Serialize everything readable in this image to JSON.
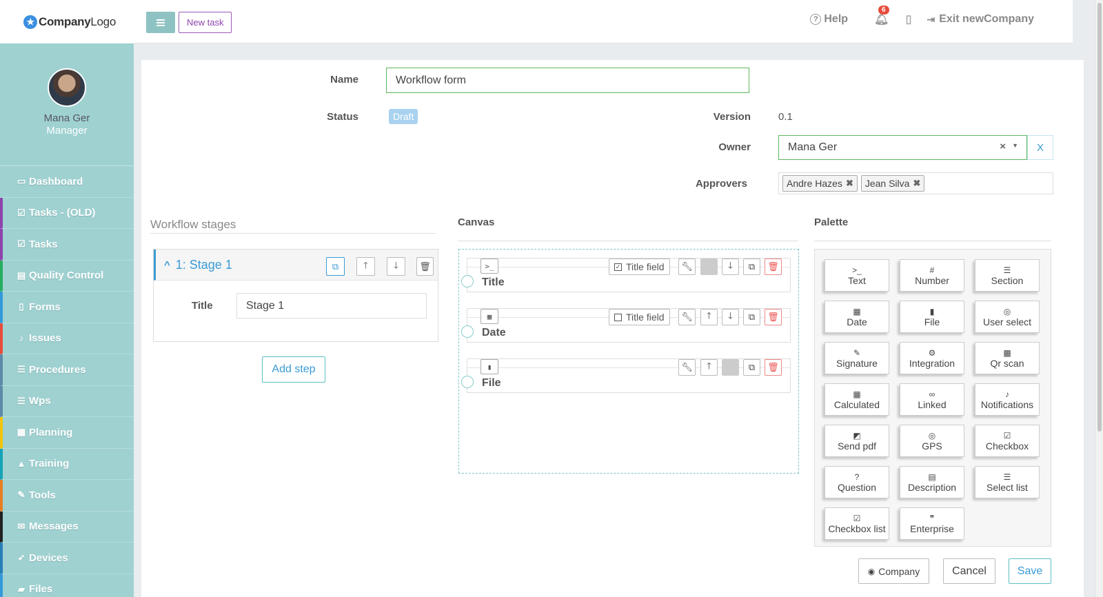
{
  "app": {
    "logo_text": "CompanyLogo",
    "logo_bold": "Company",
    "logo_rest": "Logo"
  },
  "header": {
    "new_task_label": "New task",
    "help_label": "Help",
    "notification_count": "6",
    "exit_label": "Exit newCompany"
  },
  "profile": {
    "name": "Mana Ger",
    "role": "Manager"
  },
  "sidebar": {
    "items": [
      {
        "label": "Dashboard",
        "icon": "monitor-icon",
        "color": "#9fd1d1"
      },
      {
        "label": "Tasks - (OLD)",
        "icon": "check-square-icon",
        "color": "#8e44ad"
      },
      {
        "label": "Tasks",
        "icon": "check-square-icon",
        "color": "#8e44ad"
      },
      {
        "label": "Quality Control",
        "icon": "book-icon",
        "color": "#27ae60"
      },
      {
        "label": "Forms",
        "icon": "file-icon",
        "color": "#3498db"
      },
      {
        "label": "Issues",
        "icon": "bell-icon",
        "color": "#e74c3c"
      },
      {
        "label": "Procedures",
        "icon": "list-icon",
        "color": "#5d8aa8"
      },
      {
        "label": "Wps",
        "icon": "list-icon",
        "color": "#5d8aa8"
      },
      {
        "label": "Planning",
        "icon": "calendar-icon",
        "color": "#f1c40f"
      },
      {
        "label": "Training",
        "icon": "graduation-icon",
        "color": "#16a3b8"
      },
      {
        "label": "Tools",
        "icon": "wrench-icon",
        "color": "#e67e22"
      },
      {
        "label": "Messages",
        "icon": "envelope-icon",
        "color": "#222222"
      },
      {
        "label": "Devices",
        "icon": "rocket-icon",
        "color": "#2980b9"
      },
      {
        "label": "Files",
        "icon": "folder-icon",
        "color": "#3498db"
      }
    ]
  },
  "form": {
    "name_label": "Name",
    "name_value": "Workflow form",
    "status_label": "Status",
    "status_value": "Draft",
    "version_label": "Version",
    "version_value": "0.1",
    "owner_label": "Owner",
    "owner_value": "Mana Ger",
    "owner_x_label": "X",
    "approvers_label": "Approvers",
    "approvers": [
      "Andre Hazes",
      "Jean Silva"
    ]
  },
  "stages": {
    "header": "Workflow stages",
    "items": [
      {
        "title": "1: Stage 1",
        "title_label": "Title",
        "title_value": "Stage 1"
      }
    ],
    "add_step_label": "Add step"
  },
  "canvas": {
    "header": "Canvas",
    "fields": [
      {
        "name": "Title",
        "icon": "terminal-icon",
        "title_field_label": "Title field",
        "title_field_checked": true
      },
      {
        "name": "Date",
        "icon": "calendar-icon",
        "title_field_label": "Title field",
        "title_field_checked": false
      },
      {
        "name": "File",
        "icon": "file-icon"
      }
    ]
  },
  "palette": {
    "header": "Palette",
    "items": [
      {
        "label": "Text",
        "icon": "terminal-icon"
      },
      {
        "label": "Number",
        "icon": "hash-icon"
      },
      {
        "label": "Section",
        "icon": "list-icon"
      },
      {
        "label": "Date",
        "icon": "calendar-icon"
      },
      {
        "label": "File",
        "icon": "file-icon"
      },
      {
        "label": "User select",
        "icon": "user-icon"
      },
      {
        "label": "Signature",
        "icon": "pen-icon"
      },
      {
        "label": "Integration",
        "icon": "cogs-icon"
      },
      {
        "label": "Qr scan",
        "icon": "qrcode-icon"
      },
      {
        "label": "Calculated",
        "icon": "calculator-icon"
      },
      {
        "label": "Linked",
        "icon": "link-icon"
      },
      {
        "label": "Notifications",
        "icon": "bell-icon"
      },
      {
        "label": "Send pdf",
        "icon": "send-icon"
      },
      {
        "label": "GPS",
        "icon": "target-icon"
      },
      {
        "label": "Checkbox",
        "icon": "checkbox-icon"
      },
      {
        "label": "Question",
        "icon": "question-icon"
      },
      {
        "label": "Description",
        "icon": "doc-icon"
      },
      {
        "label": "Select list",
        "icon": "list-ol-icon"
      },
      {
        "label": "Checkbox list",
        "icon": "checkbox-icon"
      },
      {
        "label": "Enterprise",
        "icon": "quote-icon"
      }
    ]
  },
  "footer": {
    "company_label": "Company",
    "cancel_label": "Cancel",
    "save_label": "Save"
  }
}
